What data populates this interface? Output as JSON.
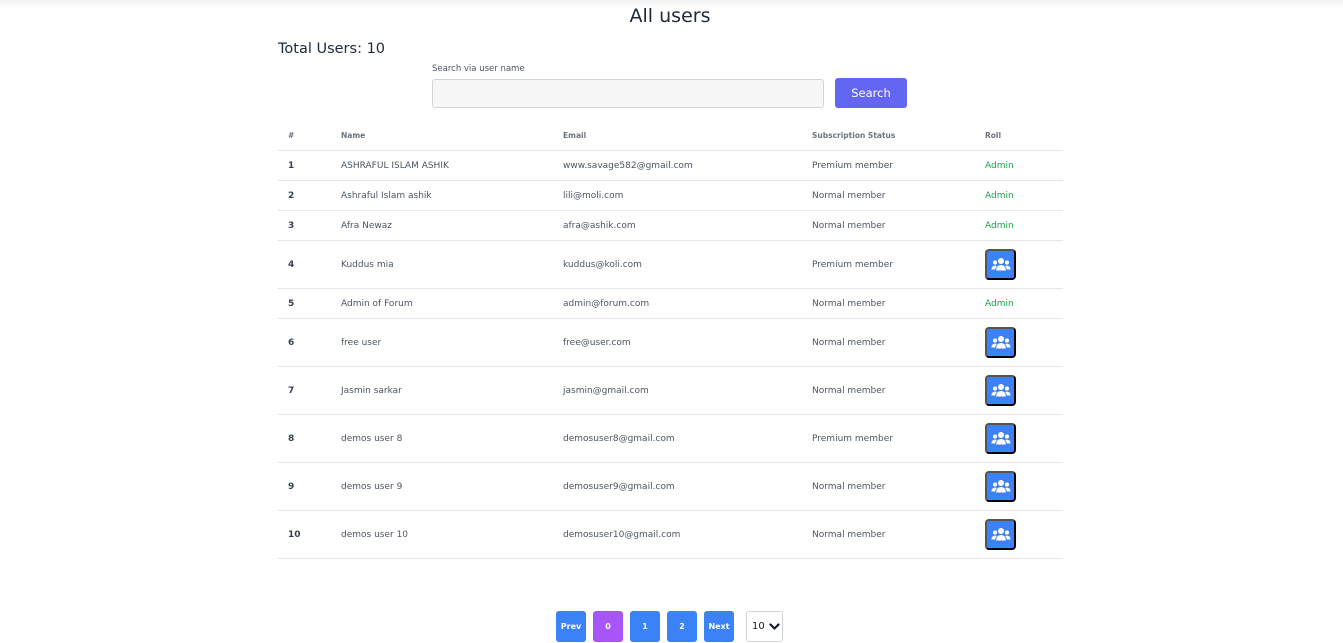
{
  "header": {
    "title": "All users",
    "total_users_label": "Total Users: 10"
  },
  "search": {
    "label": "Search via user name",
    "value": "",
    "placeholder": "",
    "button_label": "Search"
  },
  "table": {
    "columns": [
      "#",
      "Name",
      "Email",
      "Subscription Status",
      "Roll"
    ],
    "rows": [
      {
        "num": "1",
        "name": "ASHRAFUL ISLAM ASHIK",
        "email": "www.savage582@gmail.com",
        "status": "Premium member",
        "roll": "Admin"
      },
      {
        "num": "2",
        "name": "Ashraful Islam ashik",
        "email": "lili@moli.com",
        "status": "Normal member",
        "roll": "Admin"
      },
      {
        "num": "3",
        "name": "Afra Newaz",
        "email": "afra@ashik.com",
        "status": "Normal member",
        "roll": "Admin"
      },
      {
        "num": "4",
        "name": "Kuddus mia",
        "email": "kuddus@koli.com",
        "status": "Premium member",
        "roll": "make-admin-button"
      },
      {
        "num": "5",
        "name": "Admin of Forum",
        "email": "admin@forum.com",
        "status": "Normal member",
        "roll": "Admin"
      },
      {
        "num": "6",
        "name": "free user",
        "email": "free@user.com",
        "status": "Normal member",
        "roll": "make-admin-button"
      },
      {
        "num": "7",
        "name": "Jasmin sarkar",
        "email": "jasmin@gmail.com",
        "status": "Normal member",
        "roll": "make-admin-button"
      },
      {
        "num": "8",
        "name": "demos user 8",
        "email": "demosuser8@gmail.com",
        "status": "Premium member",
        "roll": "make-admin-button"
      },
      {
        "num": "9",
        "name": "demos user 9",
        "email": "demosuser9@gmail.com",
        "status": "Normal member",
        "roll": "make-admin-button"
      },
      {
        "num": "10",
        "name": "demos user 10",
        "email": "demosuser10@gmail.com",
        "status": "Normal member",
        "roll": "make-admin-button"
      }
    ]
  },
  "pagination": {
    "prev_label": "Prev",
    "pages": [
      "0",
      "1",
      "2"
    ],
    "active_page": "0",
    "next_label": "Next",
    "page_size": "10"
  },
  "icons": {
    "make_admin": "users-icon",
    "select": "chevron-down-icon"
  },
  "colors": {
    "search_button": "#6366f1",
    "action_button": "#3b82f6",
    "active_page": "#a855f7",
    "admin_text": "#16a34a"
  }
}
